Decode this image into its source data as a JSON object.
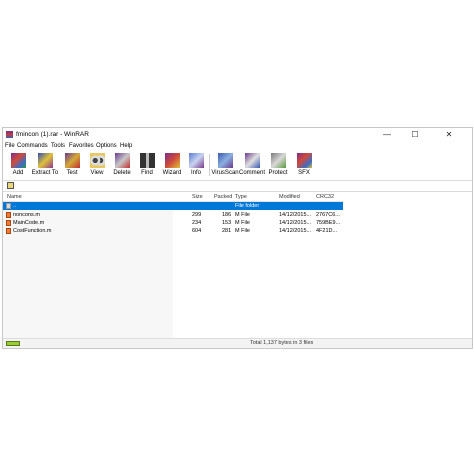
{
  "window": {
    "title": "fmincon (1).rar - WinRAR"
  },
  "controls": {
    "minimize": "—",
    "maximize": "☐",
    "close": "✕"
  },
  "menu": [
    "File",
    "Commands",
    "Tools",
    "Favorites",
    "Options",
    "Help"
  ],
  "toolbar": [
    {
      "label": "Add",
      "icon": "add-icon"
    },
    {
      "label": "Extract To",
      "icon": "extract-icon"
    },
    {
      "label": "Test",
      "icon": "test-icon"
    },
    {
      "label": "View",
      "icon": "view-icon"
    },
    {
      "label": "Delete",
      "icon": "delete-icon"
    },
    {
      "label": "Find",
      "icon": "find-icon"
    },
    {
      "label": "Wizard",
      "icon": "wizard-icon"
    },
    {
      "label": "Info",
      "icon": "info-icon"
    },
    {
      "label": "VirusScan",
      "icon": "virusscan-icon"
    },
    {
      "label": "Comment",
      "icon": "comment-icon"
    },
    {
      "label": "Protect",
      "icon": "protect-icon"
    },
    {
      "label": "SFX",
      "icon": "sfx-icon"
    }
  ],
  "columns": [
    "Name",
    "Size",
    "Packed",
    "Type",
    "Modified",
    "CRC32"
  ],
  "rows": [
    {
      "name": "..",
      "size": "",
      "packed": "",
      "type": "File folder",
      "modified": "",
      "crc": ""
    },
    {
      "name": "noncons.m",
      "size": "299",
      "packed": "186",
      "type": "M File",
      "modified": "14/12/2015...",
      "crc": "2767C6..."
    },
    {
      "name": "MainCode.m",
      "size": "234",
      "packed": "153",
      "type": "M File",
      "modified": "14/12/2015...",
      "crc": "759BE9..."
    },
    {
      "name": "CostFunction.m",
      "size": "604",
      "packed": "281",
      "type": "M File",
      "modified": "14/12/2015...",
      "crc": "4F21D..."
    }
  ],
  "status": {
    "text": "Total 1,137 bytes in 3 files"
  },
  "colors": {
    "selection": "#0078d7"
  }
}
